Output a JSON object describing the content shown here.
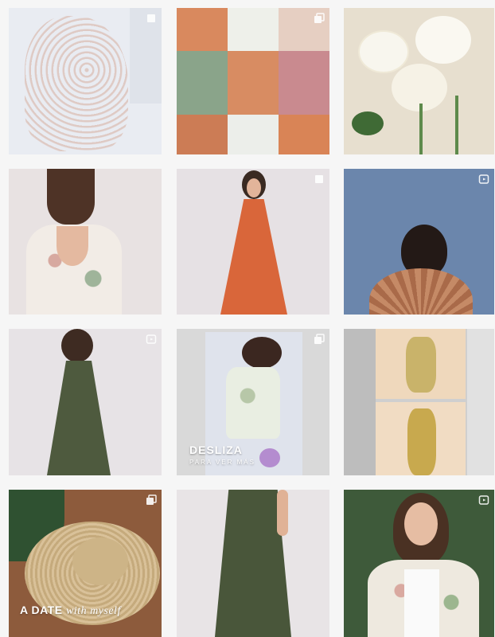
{
  "feed": {
    "posts": [
      {
        "id": "post-1",
        "media": "image",
        "subject": "embroidered white top"
      },
      {
        "id": "post-2",
        "media": "carousel",
        "subject": "terracotta collage"
      },
      {
        "id": "post-3",
        "media": "image",
        "subject": "white lilies"
      },
      {
        "id": "post-4",
        "media": "image",
        "subject": "floral back dress"
      },
      {
        "id": "post-5",
        "media": "image",
        "subject": "terracotta halter dress"
      },
      {
        "id": "post-6",
        "media": "reel",
        "subject": "blue sky head"
      },
      {
        "id": "post-7",
        "media": "reel",
        "subject": "olive maxi dress"
      },
      {
        "id": "post-8",
        "media": "carousel",
        "subject": "floral shirt dress"
      },
      {
        "id": "post-9",
        "media": "image",
        "subject": "floral set collage"
      },
      {
        "id": "post-10",
        "media": "carousel",
        "subject": "straw hat"
      },
      {
        "id": "post-11",
        "media": "image",
        "subject": "olive maxi skirt"
      },
      {
        "id": "post-12",
        "media": "reel",
        "subject": "floral jacket"
      }
    ],
    "overlays": {
      "desliza_title": "DESLIZA",
      "desliza_sub": "PARA VER MÁS",
      "date_bold": "A DATE",
      "date_italic": "with myself"
    }
  }
}
